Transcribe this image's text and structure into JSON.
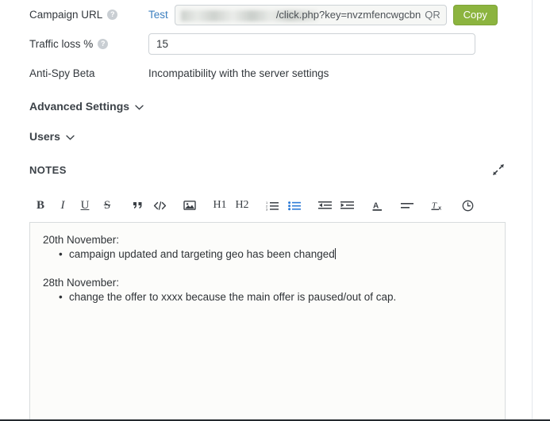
{
  "form": {
    "rows": [
      {
        "label": "Campaign URL",
        "has_help": true,
        "type": "url",
        "test_link": "Test",
        "url_value": "/click.php?key=nvzmfencwgcbn",
        "url_redacted": true,
        "qr_label": "QR",
        "copy_label": "Copy"
      },
      {
        "label": "Traffic loss %",
        "has_help": true,
        "type": "input",
        "value": "15",
        "placeholder": ""
      },
      {
        "label": "Anti-Spy Beta",
        "has_help": false,
        "type": "static",
        "value": "Incompatibility with the server settings"
      }
    ]
  },
  "collapsibles": [
    {
      "label": "Advanced Settings",
      "icon": "chevron-down-icon",
      "expanded": false
    },
    {
      "label": "Users",
      "icon": "chevron-down-icon",
      "expanded": false
    }
  ],
  "notes": {
    "title": "NOTES",
    "expand_icon": "expand-diagonal-icon",
    "toolbar": [
      {
        "name": "bold-icon",
        "label": "B",
        "active": false
      },
      {
        "name": "italic-icon",
        "label": "I",
        "active": false
      },
      {
        "name": "underline-icon",
        "label": "U",
        "active": false
      },
      {
        "name": "strikethrough-icon",
        "label": "S",
        "active": false
      },
      {
        "name": "blockquote-icon",
        "label": "”",
        "active": false
      },
      {
        "name": "code-icon",
        "label": "</>",
        "active": false
      },
      {
        "name": "image-icon",
        "label": "ὛC",
        "active": false
      },
      {
        "name": "heading-1-icon",
        "label": "H1",
        "active": false
      },
      {
        "name": "heading-2-icon",
        "label": "H2",
        "active": false
      },
      {
        "name": "ordered-list-icon",
        "label": "",
        "active": false
      },
      {
        "name": "unordered-list-icon",
        "label": "",
        "active": true
      },
      {
        "name": "outdent-icon",
        "label": "",
        "active": false
      },
      {
        "name": "indent-icon",
        "label": "",
        "active": false
      },
      {
        "name": "text-color-icon",
        "label": "A",
        "active": false
      },
      {
        "name": "align-icon",
        "label": "",
        "active": false
      },
      {
        "name": "clear-format-icon",
        "label": "Tx",
        "active": false
      },
      {
        "name": "history-clock-icon",
        "label": "",
        "active": false
      }
    ],
    "content": [
      {
        "kind": "line",
        "text": "20th November:"
      },
      {
        "kind": "bullet",
        "text": "campaign updated and targeting geo has been changed",
        "caret": true
      },
      {
        "kind": "gap",
        "text": ""
      },
      {
        "kind": "line",
        "text": "28th November:"
      },
      {
        "kind": "bullet",
        "text": "change the offer to xxxx because the main offer is paused/out of cap.",
        "caret": false
      }
    ]
  },
  "colors": {
    "accent_blue": "#2c7ad6",
    "link_blue": "#3c7fbf",
    "copy_green": "#8cb43f",
    "text_dark": "#33383d",
    "border": "#cdd2d6"
  }
}
